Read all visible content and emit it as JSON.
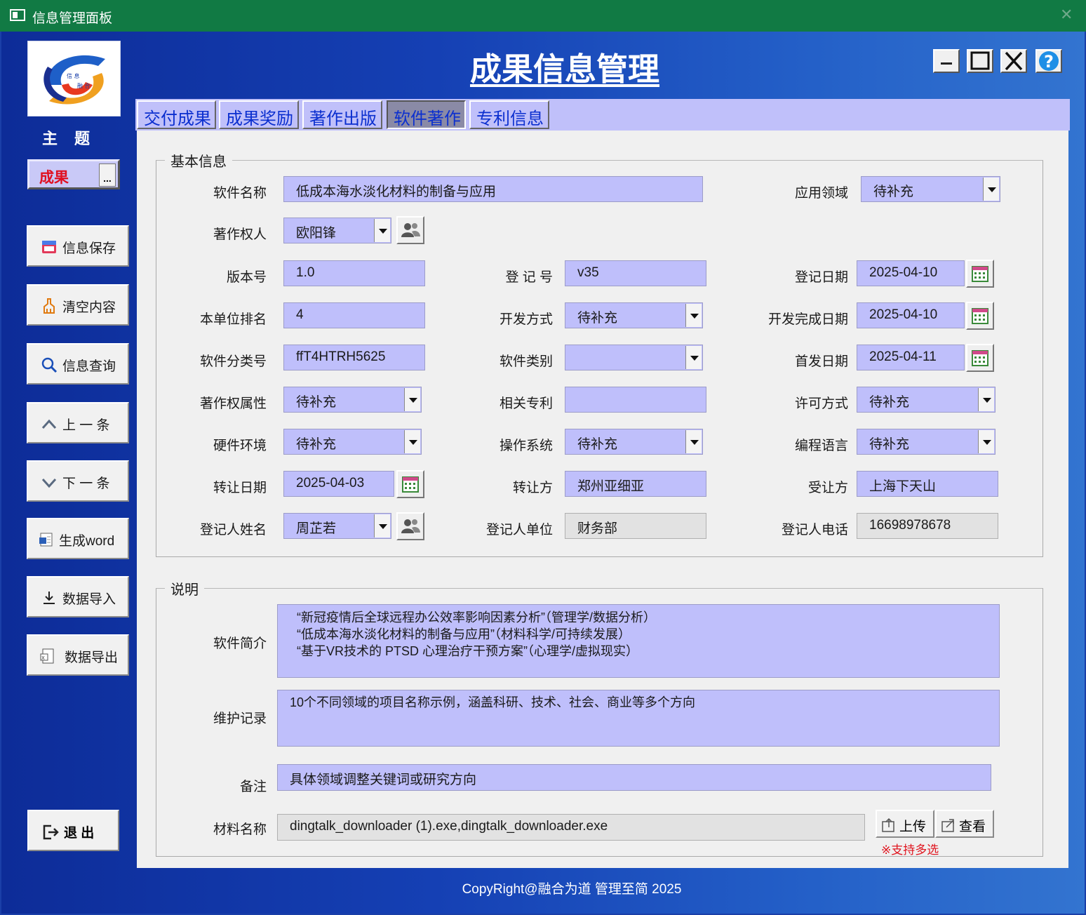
{
  "window": {
    "title": "信息管理面板",
    "close": "✕"
  },
  "sidebar": {
    "theme_label": "主题",
    "theme_value": "成果",
    "theme_more": "...",
    "buttons": [
      {
        "label": "信息保存",
        "icon": "save-icon"
      },
      {
        "label": "清空内容",
        "icon": "broom-icon"
      },
      {
        "label": "信息查询",
        "icon": "search-icon"
      },
      {
        "label": "上 一 条",
        "icon": "chevron-up-icon"
      },
      {
        "label": "下 一 条",
        "icon": "chevron-down-icon"
      },
      {
        "label": "生成word",
        "icon": "word-doc-icon"
      },
      {
        "label": "数据导入",
        "icon": "import-icon"
      },
      {
        "label": "数据导出",
        "icon": "export-icon"
      }
    ],
    "exit_label": "退 出"
  },
  "header": {
    "title": "成果信息管理"
  },
  "tabs": [
    "交付成果",
    "成果奖励",
    "著作出版",
    "软件著作",
    "专利信息"
  ],
  "active_tab": "软件著作",
  "basic": {
    "legend": "基本信息",
    "software_name": {
      "label": "软件名称",
      "value": "低成本海水淡化材料的制备与应用"
    },
    "app_field": {
      "label": "应用领域",
      "value": "待补充"
    },
    "copyright_owner": {
      "label": "著作权人",
      "value": "欧阳锋"
    },
    "version": {
      "label": "版本号",
      "value": "1.0"
    },
    "reg_no": {
      "label": "登 记 号",
      "value": "v35"
    },
    "reg_date": {
      "label": "登记日期",
      "value": "2025-04-10"
    },
    "unit_rank": {
      "label": "本单位排名",
      "value": "4"
    },
    "dev_method": {
      "label": "开发方式",
      "value": "待补充"
    },
    "dev_done_date": {
      "label": "开发完成日期",
      "value": "2025-04-10"
    },
    "class_no": {
      "label": "软件分类号",
      "value": "ffT4HTRH5625"
    },
    "sw_category": {
      "label": "软件类别",
      "value": ""
    },
    "first_release": {
      "label": "首发日期",
      "value": "2025-04-11"
    },
    "cr_attr": {
      "label": "著作权属性",
      "value": "待补充"
    },
    "related_patent": {
      "label": "相关专利",
      "value": ""
    },
    "license": {
      "label": "许可方式",
      "value": "待补充"
    },
    "hardware": {
      "label": "硬件环境",
      "value": "待补充"
    },
    "os": {
      "label": "操作系统",
      "value": "待补充"
    },
    "lang": {
      "label": "编程语言",
      "value": "待补充"
    },
    "transfer_date": {
      "label": "转让日期",
      "value": "2025-04-03"
    },
    "transferor": {
      "label": "转让方",
      "value": "郑州亚细亚"
    },
    "transferee": {
      "label": "受让方",
      "value": "上海下天山"
    },
    "registrant": {
      "label": "登记人姓名",
      "value": "周芷若"
    },
    "reg_unit": {
      "label": "登记人单位",
      "value": "财务部"
    },
    "reg_phone": {
      "label": "登记人电话",
      "value": "16698978678"
    }
  },
  "desc": {
    "legend": "说明",
    "intro_label": "软件简介",
    "intro_lines": [
      "“新冠疫情后全球远程办公效率影响因素分析”（管理学/数据分析）",
      "“低成本海水淡化材料的制备与应用”（材料科学/可持续发展）",
      "“基于VR技术的 PTSD 心理治疗干预方案”（心理学/虚拟现实）"
    ],
    "maint_label": "维护记录",
    "maint_value": "10个不同领域的项目名称示例，涵盖科研、技术、社会、商业等多个方向",
    "remark_label": "备注",
    "remark_value": "具体领域调整关键词或研究方向",
    "material_label": "材料名称",
    "material_value": "dingtalk_downloader (1).exe,dingtalk_downloader.exe",
    "upload_label": "上传",
    "view_label": "查看",
    "multi_note": "※支持多选"
  },
  "footer": "CopyRight@融合为道 管理至简 2025",
  "colors": {
    "titlebar": "#117a44",
    "field": "#bfbffb",
    "tab_text": "#0b2fcf",
    "accent_red": "#e01020"
  }
}
